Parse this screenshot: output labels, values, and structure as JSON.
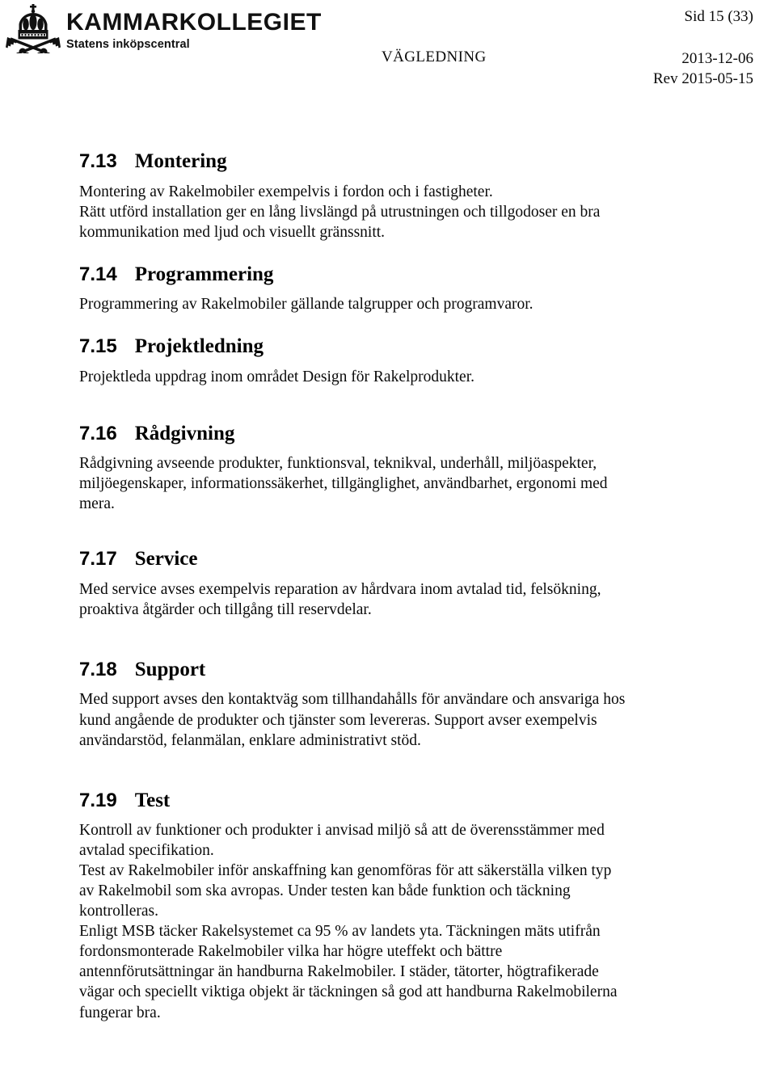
{
  "header": {
    "logo": {
      "emblem_name": "crown-and-crossed-keys-emblem",
      "title": "KAMMARKOLLEGIET",
      "subtitle": "Statens inköpscentral"
    },
    "page_number": "Sid 15 (33)",
    "doc_type": "VÄGLEDNING",
    "date": "2013-12-06",
    "revision": "Rev 2015-05-15"
  },
  "sections": [
    {
      "number": "7.13",
      "title": "Montering",
      "paragraphs": [
        "Montering av Rakelmobiler exempelvis i fordon och i fastigheter.",
        "Rätt utförd installation ger en lång livslängd på utrustningen och tillgodoser en bra kommunikation med ljud och visuellt gränssnitt."
      ]
    },
    {
      "number": "7.14",
      "title": "Programmering",
      "paragraphs": [
        "Programmering av Rakelmobiler gällande talgrupper och programvaror."
      ]
    },
    {
      "number": "7.15",
      "title": "Projektledning",
      "paragraphs": [
        "Projektleda uppdrag inom området Design för Rakelprodukter."
      ]
    },
    {
      "number": "7.16",
      "title": "Rådgivning",
      "paragraphs": [
        "Rådgivning avseende produkter, funktionsval, teknikval, underhåll, miljöaspekter, miljöegenskaper, informationssäkerhet, tillgänglighet, användbarhet, ergonomi med mera."
      ]
    },
    {
      "number": "7.17",
      "title": "Service",
      "paragraphs": [
        "Med service avses exempelvis reparation av hårdvara inom avtalad tid, felsökning, proaktiva åtgärder och tillgång till reservdelar."
      ]
    },
    {
      "number": "7.18",
      "title": "Support",
      "paragraphs": [
        "Med support avses den kontaktväg som tillhandahålls för användare och ansvariga hos kund angående de produkter och tjänster som levereras. Support avser exempelvis användarstöd, felanmälan, enklare administrativt stöd."
      ]
    },
    {
      "number": "7.19",
      "title": "Test",
      "paragraphs": [
        "Kontroll av funktioner och produkter i anvisad miljö så att de överensstämmer med avtalad specifikation.",
        "Test av Rakelmobiler inför anskaffning kan genomföras för att säkerställa vilken typ av Rakelmobil som ska avropas. Under testen kan både funktion och täckning kontrolleras.",
        "Enligt MSB täcker Rakelsystemet ca 95 % av landets yta. Täckningen mäts utifrån fordonsmonterade Rakelmobiler vilka har högre uteffekt och bättre antennförutsättningar än handburna Rakelmobiler. I städer, tätorter, högtrafikerade vägar och speciellt viktiga objekt är täckningen så god att handburna Rakelmobilerna fungerar bra."
      ]
    }
  ]
}
